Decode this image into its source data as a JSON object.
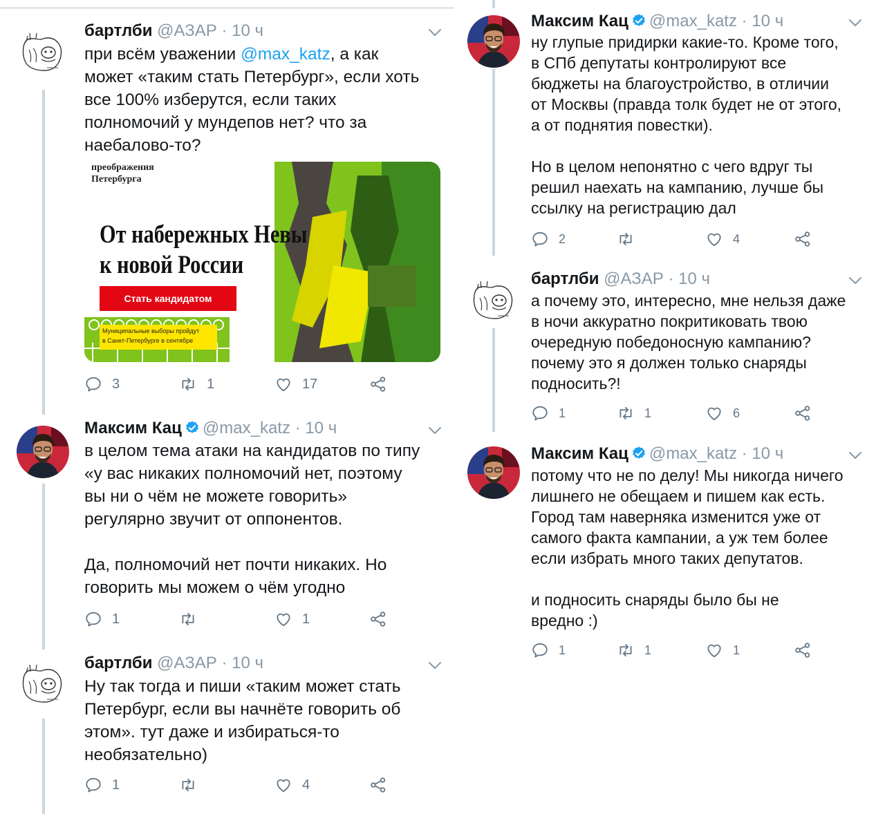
{
  "tweets": [
    {
      "author": "бартлби",
      "handle": "@АЗАР",
      "time": "10 ч",
      "dot": "·",
      "text_before": "при всём уважении ",
      "mention": "@max_katz",
      "text_after": ", а как\nможет «таким стать Петербург», если хоть\nвсе 100% изберутся, если таких\nполномочий у мундепов нет? что за\nнаебалово-то?",
      "card": {
        "kicker": "преображения\nПетербурга",
        "headline_1": "От набережных Невы",
        "headline_2": "к новой России",
        "cta": "Стать кандидатом",
        "footnote": "Муниципальные выборы пройдут\nв Санкт-Петербурге в сентябре"
      },
      "replies": "3",
      "retweets": "1",
      "likes": "17"
    },
    {
      "author": "Максим Кац",
      "handle": "@max_katz",
      "time": "10 ч",
      "dot": "·",
      "text": "в целом тема атаки на кандидатов по типу\n«у вас никаких полномочий нет, поэтому\nвы ни о чём не можете говорить»\nрегулярно звучит от оппонентов.\n\nДа, полномочий нет почти никаких. Но\nговорить мы можем о чём угодно",
      "replies": "1",
      "retweets": "",
      "likes": "1"
    },
    {
      "author": "бартлби",
      "handle": "@АЗАР",
      "time": "10 ч",
      "dot": "·",
      "text": "Ну так тогда и пиши «таким может стать\nПетербург, если вы начнёте говорить об\nэтом». тут даже и избираться-то\nнеобязательно)",
      "replies": "1",
      "retweets": "",
      "likes": "4"
    },
    {
      "author": "Максим Кац",
      "handle": "@max_katz",
      "time": "10 ч",
      "dot": "·",
      "text": "ну глупые придирки какие-то. Кроме того,\nв СПб депутаты контролируют все\nбюджеты на благоустройство, в отличии\nот Москвы (правда толк будет не от этого,\nа от поднятия повестки).\n\nНо в целом непонятно с чего вдруг ты\nрешил наехать на кампанию, лучше бы\nссылку на регистрацию дал",
      "replies": "2",
      "retweets": "",
      "likes": "4"
    },
    {
      "author": "бартлби",
      "handle": "@АЗАР",
      "time": "10 ч",
      "dot": "·",
      "text": "а почему это, интересно, мне нельзя даже\nв ночи аккуратно покритиковать твою\nочередную победоносную кампанию?\nпочему это я должен только снаряды\nподносить?!",
      "replies": "1",
      "retweets": "1",
      "likes": "6"
    },
    {
      "author": "Максим Кац",
      "handle": "@max_katz",
      "time": "10 ч",
      "dot": "·",
      "text": "потому что не по делу! Мы никогда ничего\nлишнего не обещаем и пишем как есть.\nГород там наверняка изменится уже от\nсамого факта кампании, а уж тем более\nесли избрать много таких депутатов.\n\nи подносить снаряды было бы не\nвредно :)",
      "replies": "1",
      "retweets": "1",
      "likes": "1"
    }
  ],
  "colors": {
    "text": "#14171a",
    "secondary": "#657786",
    "handle": "#8899a6",
    "link": "#1da1f2",
    "verified": "#1da1f2",
    "thread_line": "#ccd6dd",
    "cta_red": "#e30613",
    "card_green": "#7fc31c"
  },
  "icons": [
    "reply-icon",
    "retweet-icon",
    "like-icon",
    "share-icon",
    "verified-badge-icon",
    "chevron-down-icon"
  ]
}
